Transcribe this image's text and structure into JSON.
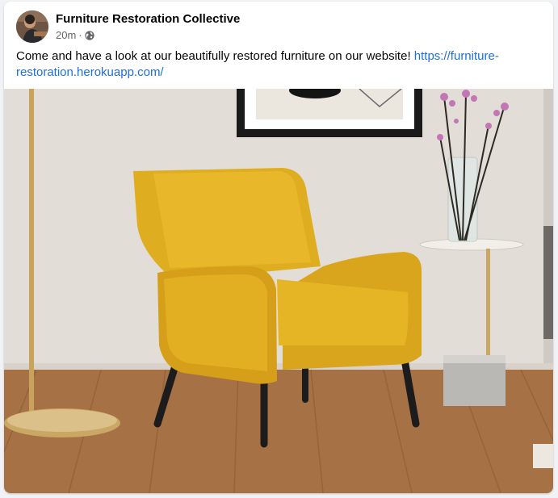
{
  "post": {
    "author": "Furniture Restoration Collective",
    "time": "20m",
    "separator": "·",
    "privacy_icon": "globe-icon",
    "message": "Come and have a look at our beautifully restored furniture on our website! ",
    "link_text": "https://furniture-restoration.herokuapp.com/"
  },
  "photo": {
    "subject": "yellow armchair",
    "colors": {
      "wall": "#e5e1db",
      "floor": "#a26f43",
      "chair": "#e4b321",
      "brass": "#c9a765"
    }
  },
  "colors": {
    "link": "#216fdb",
    "secondary_text": "#65676b",
    "primary_text": "#050505"
  }
}
